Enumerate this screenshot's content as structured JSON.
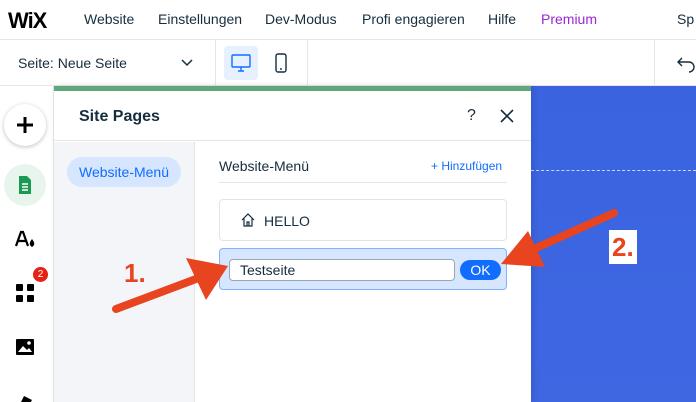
{
  "topbar": {
    "logo": "WiX",
    "menu": [
      {
        "label": "Website"
      },
      {
        "label": "Einstellungen"
      },
      {
        "label": "Dev-Modus"
      },
      {
        "label": "Profi engagieren"
      },
      {
        "label": "Hilfe"
      },
      {
        "label": "Premium"
      },
      {
        "label": "Sp"
      }
    ]
  },
  "toolbar": {
    "page_label": "Seite:",
    "page_value": "Neue Seite"
  },
  "rail": {
    "apps_badge": "2"
  },
  "panel": {
    "title": "Site Pages",
    "help": "?",
    "left_menu_item": "Website-Menü",
    "section_title": "Website-Menü",
    "add_link": "+ Hinzufügen",
    "pages": [
      {
        "name": "HELLO"
      }
    ],
    "edit": {
      "value": "Testseite",
      "ok_label": "OK"
    }
  },
  "annotations": {
    "step1": "1.",
    "step2": "2."
  },
  "colors": {
    "accent": "#116dff",
    "premium": "#9a27d5",
    "panel_top": "#60a87b",
    "canvas": "#4a6fe3",
    "annotation": "#e8441f"
  }
}
